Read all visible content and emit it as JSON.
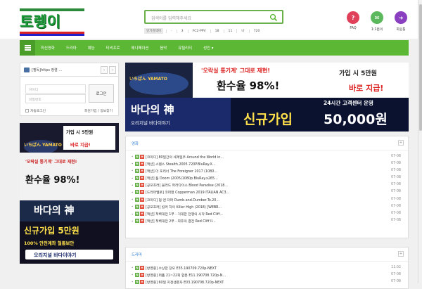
{
  "logo": {
    "text": "토렝이"
  },
  "search": {
    "placeholder": "검색어를 입력해주세요"
  },
  "tags": {
    "label": "인기검색어",
    "items": [
      "·",
      "3",
      "FC2-PPV",
      "18",
      "11",
      "나",
      "720"
    ]
  },
  "header_icons": [
    {
      "label": "FAQ",
      "color": "#e0405a",
      "glyph": "?"
    },
    {
      "label": "1:1문의",
      "color": "#5cb85c",
      "glyph": "✉"
    },
    {
      "label": "회원툴",
      "color": "#8a3ec0",
      "glyph": "➜"
    }
  ],
  "nav": {
    "items": [
      "최신영화",
      "드라마",
      "예능",
      "티비프로",
      "애니메이션",
      "음악",
      "유틸리티",
      "성인 ▾"
    ]
  },
  "notice": {
    "text": "[필독]https 정렬 ...",
    "prev": "‹",
    "next": "›"
  },
  "login": {
    "id_placeholder": "아이디",
    "pw_placeholder": "비밀번호",
    "button": "로그인",
    "auto_login": "자동로그인",
    "links": "회원가입 / 정보찾기"
  },
  "ads": {
    "brand": "いちばん YAMATO",
    "banner_a": "가입 시 5만원",
    "banner_b": "바로 지급!",
    "line1": "'오락실 통기계' 그대로 재현!",
    "line2": "환수율 98%!",
    "logo2": "바다의 神",
    "sub2": "오리지널 바다이야기",
    "service": "24시간 고객센터 운영",
    "signup": "신규가입",
    "signup_amount": "50,000원",
    "left_signup": "신규가입 5만원",
    "left_safe": "100% 안전계좌 철통보안"
  },
  "colors": {
    "accent": "#5bb734",
    "link": "#2a7ad2",
    "new": "#6ab04c",
    "hot": "#e14d3a"
  },
  "movies": {
    "title": "영화",
    "more": "+",
    "rows": [
      {
        "title": "[코미디] 80일간의 세계일주 Around the World in...",
        "date": "07-08"
      },
      {
        "title": "[액션] 스텔스 Stealth.2005.720P.BluRay.X...",
        "date": "07-08"
      },
      {
        "title": "[액션] 더 포리너 The Foreigner 2017 (1080...",
        "date": "07-08"
      },
      {
        "title": "[액션] 둠 Doom (2005)1080p.BluRay.x265...",
        "date": "07-08"
      },
      {
        "title": "[공포호러] 블러드 파라다이스 Blood Paradise (2018...",
        "date": "07-08"
      },
      {
        "title": "[드라마멜로] 코퍼맨 Copperman 2019 ITALIAN AC3...",
        "date": "07-08"
      },
      {
        "title": "[코미디] 덤 앤 더머 Dumb.and.Dumber.To.20...",
        "date": "07-08"
      },
      {
        "title": "[공포호러] 킬러 하이 Killer High (2018) [WEBR...",
        "date": "07-08"
      },
      {
        "title": "[액션] 적벽대전 1부 - 거대한 전쟁의 시작 Red Cliff...",
        "date": "07-08"
      },
      {
        "title": "[액션] 적벽대전 2부 - 최후의 결전 Red Cliff II...",
        "date": "07-08"
      }
    ]
  },
  "dramas": {
    "title": "드라마",
    "more": "+",
    "rows": [
      {
        "title": "[방영중] 수상한 장모 E35.190709.720p-NEXT",
        "date": "11:02"
      },
      {
        "title": "[방영중] 퍼퓸 21~22회 합본 E11.190708.720p-N...",
        "date": "07-08"
      },
      {
        "title": "[방영중] 60일 지정생존자 E03.190708.720p-NEXT",
        "date": "07-08"
      }
    ]
  }
}
